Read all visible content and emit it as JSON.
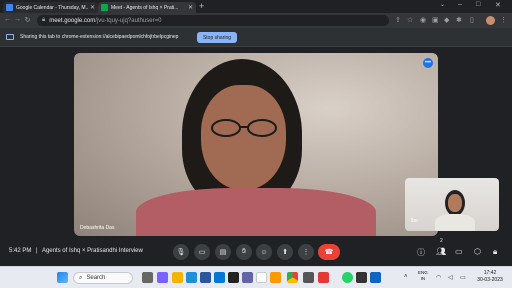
{
  "browser": {
    "tabs": [
      {
        "title": "Google Calendar - Thursday, M...",
        "favicon_color": "#4285f4"
      },
      {
        "title": "Meet - Agents of Ishq × Prati...",
        "favicon_color": "#00ac47"
      }
    ],
    "new_tab_label": "+",
    "url_host": "meet.google.com",
    "url_path": "/jvu-tquy-ujq?authuser=0",
    "nav_back": "←",
    "nav_forward": "→",
    "nav_reload": "↻"
  },
  "infobar": {
    "message": "Sharing this tab to chrome-extension://alcebipaedpomlchfojtrbelpcginep",
    "stop_label": "Stop sharing"
  },
  "meet": {
    "main_participant_name": "Debashrita Das",
    "self_label": "lbo",
    "participant_count": "2",
    "time": "5:42 PM",
    "separator": "|",
    "meeting_title": "Agents of Ishq × Pratisandhi Interview"
  },
  "taskbar": {
    "search_label": "Search",
    "lang_line1": "ENG",
    "lang_line2": "IN",
    "clock_time": "17:42",
    "clock_date": "30-03-2023"
  },
  "colors": {
    "accent": "#8ab4f8",
    "end_call": "#ea4335",
    "brand_blue": "#1a73e8"
  }
}
